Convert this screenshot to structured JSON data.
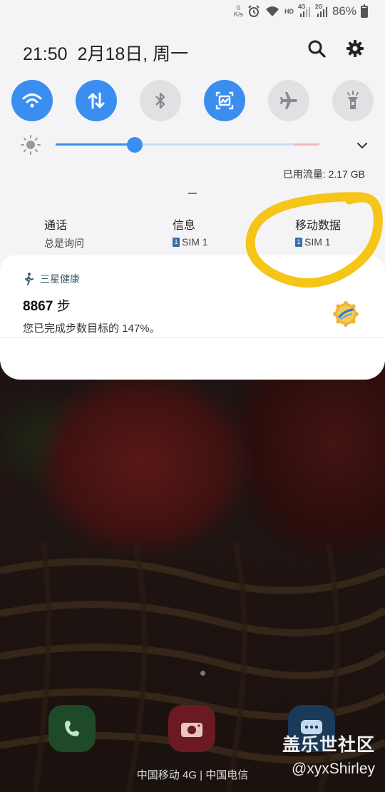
{
  "status_bar": {
    "net_speed_value": "0",
    "net_speed_unit": "K/s",
    "hd_label": "HD",
    "sim1_network": "4G",
    "sim2_network": "2G",
    "battery_percent": "86%",
    "battery_level": 0.86,
    "icons": [
      "alarm-icon",
      "wifi-icon",
      "signal-sim1-icon",
      "signal-sim2-icon",
      "battery-icon"
    ]
  },
  "quick_panel": {
    "time": "21:50",
    "date": "2月18日, 周一",
    "search_icon": "search-icon",
    "settings_icon": "gear-icon",
    "toggles": [
      {
        "name": "wifi",
        "icon": "wifi-icon",
        "on": true
      },
      {
        "name": "mobile-data",
        "icon": "arrows-updown-icon",
        "on": true
      },
      {
        "name": "bluetooth",
        "icon": "bluetooth-icon",
        "on": false
      },
      {
        "name": "screenshot",
        "icon": "screen-capture-icon",
        "on": true
      },
      {
        "name": "airplane",
        "icon": "airplane-icon",
        "on": false
      },
      {
        "name": "flashlight",
        "icon": "flashlight-icon",
        "on": false
      }
    ],
    "brightness_level": 0.3,
    "data_usage": "已用流量: 2.17 GB",
    "sim_settings": [
      {
        "title": "通话",
        "value": "总是询问",
        "badge": ""
      },
      {
        "title": "信息",
        "value": "SIM 1",
        "badge": "1"
      },
      {
        "title": "移动数据",
        "value": "SIM 1",
        "badge": "1"
      }
    ],
    "accent_color": "#3a8ef0"
  },
  "notification": {
    "app_name": "三星健康",
    "title_number": "8867",
    "title_unit": "步",
    "text": "您已完成步数目标的 147%。"
  },
  "home": {
    "dock_apps": [
      "phone-icon",
      "camera-icon",
      "messages-icon"
    ],
    "carrier_text": "中国移动 4G | 中国电信"
  },
  "watermark": {
    "line1": "盖乐世社区",
    "line2": "@xyxShirley"
  }
}
